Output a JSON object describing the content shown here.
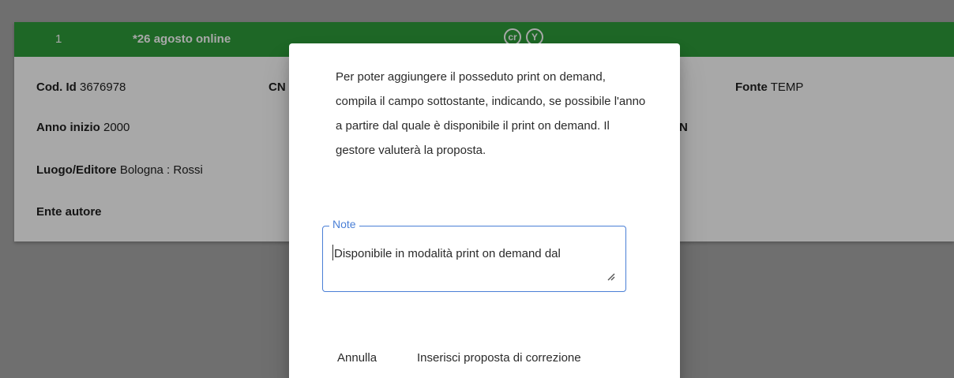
{
  "card": {
    "number": "1",
    "title": "*26 agosto online",
    "badges": [
      "cr",
      "Y"
    ],
    "fields": {
      "cod_id": {
        "label": "Cod. Id",
        "value": "3676978"
      },
      "cn_partial": "CN",
      "fonte": {
        "label": "Fonte",
        "value": "TEMP"
      },
      "anno_inizio": {
        "label": "Anno inizio",
        "value": "2000"
      },
      "n_partial": "N",
      "luogo_editore": {
        "label": "Luogo/Editore",
        "value": "Bologna : Rossi"
      },
      "ente_autore": {
        "label": "Ente autore"
      }
    }
  },
  "dialog": {
    "message": "Per poter aggiungere il posseduto print on demand, compila il campo sottostante, indicando, se possibile l'anno a partire dal quale è disponibile il print on demand. Il gestore valuterà la proposta.",
    "note": {
      "label": "Note",
      "value": "Disponibile in modalità print on demand dal"
    },
    "cancel_label": "Annulla",
    "submit_label": "Inserisci proposta di correzione"
  },
  "colors": {
    "header_green": "#2e9d3b",
    "accent_blue": "#4a7fd6"
  }
}
